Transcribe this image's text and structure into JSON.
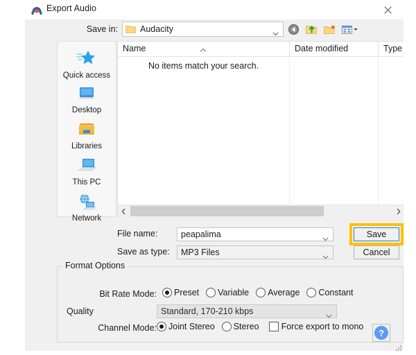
{
  "window": {
    "title": "Export Audio",
    "app_icon": "audacity-headphones-icon",
    "close_label": "✕"
  },
  "savein": {
    "label": "Save in:",
    "value": "Audacity",
    "folder_icon": "folder-icon",
    "dropdown_icon": "chevron-down-icon"
  },
  "toolbar": {
    "items": [
      {
        "name": "back-button",
        "icon": "back-arrow-icon"
      },
      {
        "name": "up-one-level-button",
        "icon": "up-folder-icon"
      },
      {
        "name": "new-folder-button",
        "icon": "new-folder-icon"
      },
      {
        "name": "views-button",
        "icon": "views-grid-icon"
      }
    ]
  },
  "places": {
    "items": [
      {
        "label": "Quick access",
        "icon": "star-icon"
      },
      {
        "label": "Desktop",
        "icon": "monitor-icon"
      },
      {
        "label": "Libraries",
        "icon": "libraries-folder-icon"
      },
      {
        "label": "This PC",
        "icon": "computer-icon"
      },
      {
        "label": "Network",
        "icon": "network-globe-icon"
      }
    ]
  },
  "filelist": {
    "columns": [
      "Name",
      "Date modified",
      "Type"
    ],
    "sort_column": "Name",
    "sort_direction": "ascending",
    "rows": [],
    "empty_message": "No items match your search.",
    "scroll": {
      "left_arrow": "‹",
      "right_arrow": "›"
    }
  },
  "form": {
    "filename_label": "File name:",
    "filename_value": "peapalima",
    "filetype_label": "Save as type:",
    "filetype_value": "MP3 Files",
    "save_label": "Save",
    "cancel_label": "Cancel",
    "save_highlight_color": "#ffc000",
    "save_focus_color": "#2a7fc9"
  },
  "format_options": {
    "title": "Format Options",
    "bitrate": {
      "label": "Bit Rate Mode:",
      "options": [
        "Preset",
        "Variable",
        "Average",
        "Constant"
      ],
      "selected": "Preset"
    },
    "quality": {
      "label": "Quality",
      "value": "Standard, 170-210 kbps",
      "disabled": true
    },
    "channel": {
      "label": "Channel Mode:",
      "options": [
        "Joint Stereo",
        "Stereo"
      ],
      "selected": "Joint Stereo",
      "mono_checkbox_label": "Force export to mono",
      "mono_checked": false
    },
    "help_label": "?"
  }
}
